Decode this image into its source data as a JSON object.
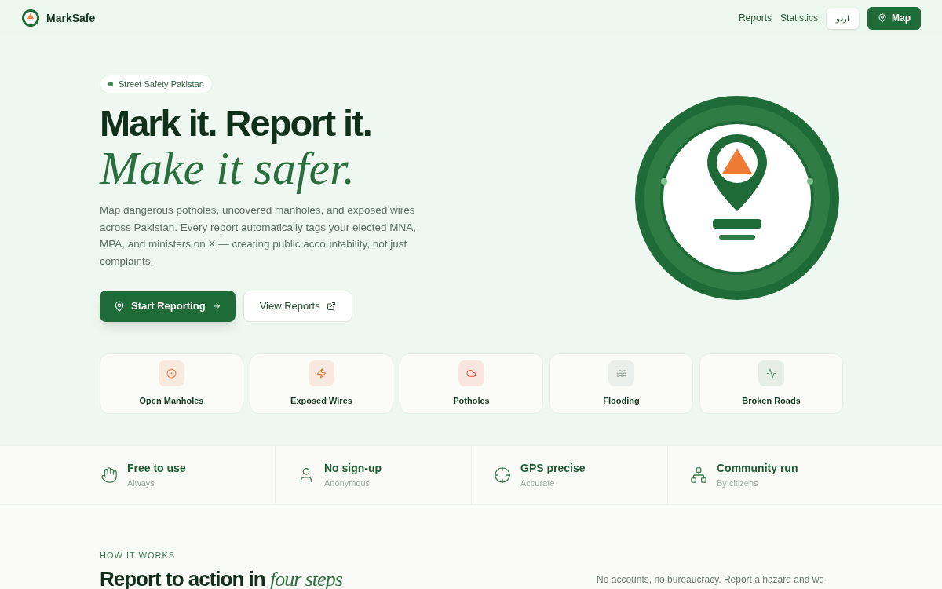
{
  "header": {
    "brand": "MarkSafe",
    "nav": [
      "Reports",
      "Statistics"
    ],
    "language": "اردو",
    "map_button": "Map"
  },
  "hero": {
    "tag": "Street Safety Pakistan",
    "title_line1": "Mark it. Report it.",
    "title_line2": "Make it safer.",
    "description": "Map dangerous potholes, uncovered manholes, and exposed wires across Pakistan. Every report automatically tags your elected MNA, MPA, and ministers on X — creating public accountability, not just complaints.",
    "primary_button": "Start Reporting",
    "secondary_button": "View Reports"
  },
  "categories": [
    {
      "label": "Open Manholes",
      "kind": "manhole",
      "color": "#ea7a3a"
    },
    {
      "label": "Exposed Wires",
      "kind": "wires",
      "color": "#ea7a3a"
    },
    {
      "label": "Potholes",
      "kind": "pothole",
      "color": "#e5573a"
    },
    {
      "label": "Flooding",
      "kind": "flood",
      "color": "#8a9a93"
    },
    {
      "label": "Broken Roads",
      "kind": "road",
      "color": "#5f9a70"
    }
  ],
  "features": [
    {
      "title": "Free to use",
      "subtitle": "Always",
      "kind": "hand"
    },
    {
      "title": "No sign-up",
      "subtitle": "Anonymous",
      "kind": "person"
    },
    {
      "title": "GPS precise",
      "subtitle": "Accurate",
      "kind": "target"
    },
    {
      "title": "Community run",
      "subtitle": "By citizens",
      "kind": "network"
    }
  ],
  "how_it_works": {
    "eyebrow": "HOW IT WORKS",
    "heading": "Report to action in",
    "heading_accent": "four steps",
    "intro": "No accounts, no bureaucracy. Report a hazard and we"
  }
}
